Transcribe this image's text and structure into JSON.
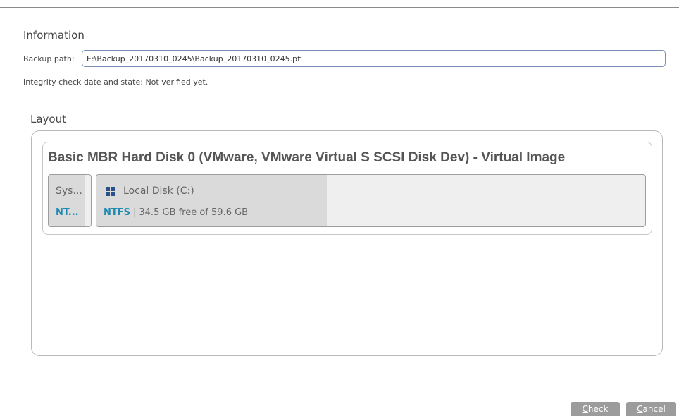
{
  "information": {
    "title": "Information",
    "backup_path_label": "Backup path:",
    "backup_path_value": "E:\\Backup_20170310_0245\\Backup_20170310_0245.pfi",
    "integrity_text": "Integrity check date and state:  Not verified yet."
  },
  "layout": {
    "title": "Layout",
    "disk": {
      "title": "Basic MBR Hard Disk 0 (VMware, VMware Virtual S SCSI Disk Dev) - Virtual Image",
      "partitions": [
        {
          "name": "Sys...",
          "fs": "NT...",
          "used_fraction": 0.85
        },
        {
          "name": "Local Disk (C:)",
          "icon": "windows-icon",
          "fs": "NTFS",
          "space": "34.5 GB free of 59.6 GB",
          "used_fraction": 0.42
        }
      ]
    }
  },
  "buttons": {
    "check_accesskey": "C",
    "check_rest": "heck",
    "cancel_accesskey": "C",
    "cancel_rest": "ancel"
  },
  "colors": {
    "fs_accent": "#1f8bb0",
    "button_bg": "#9c9c9c",
    "field_border": "#7b8cb8"
  }
}
